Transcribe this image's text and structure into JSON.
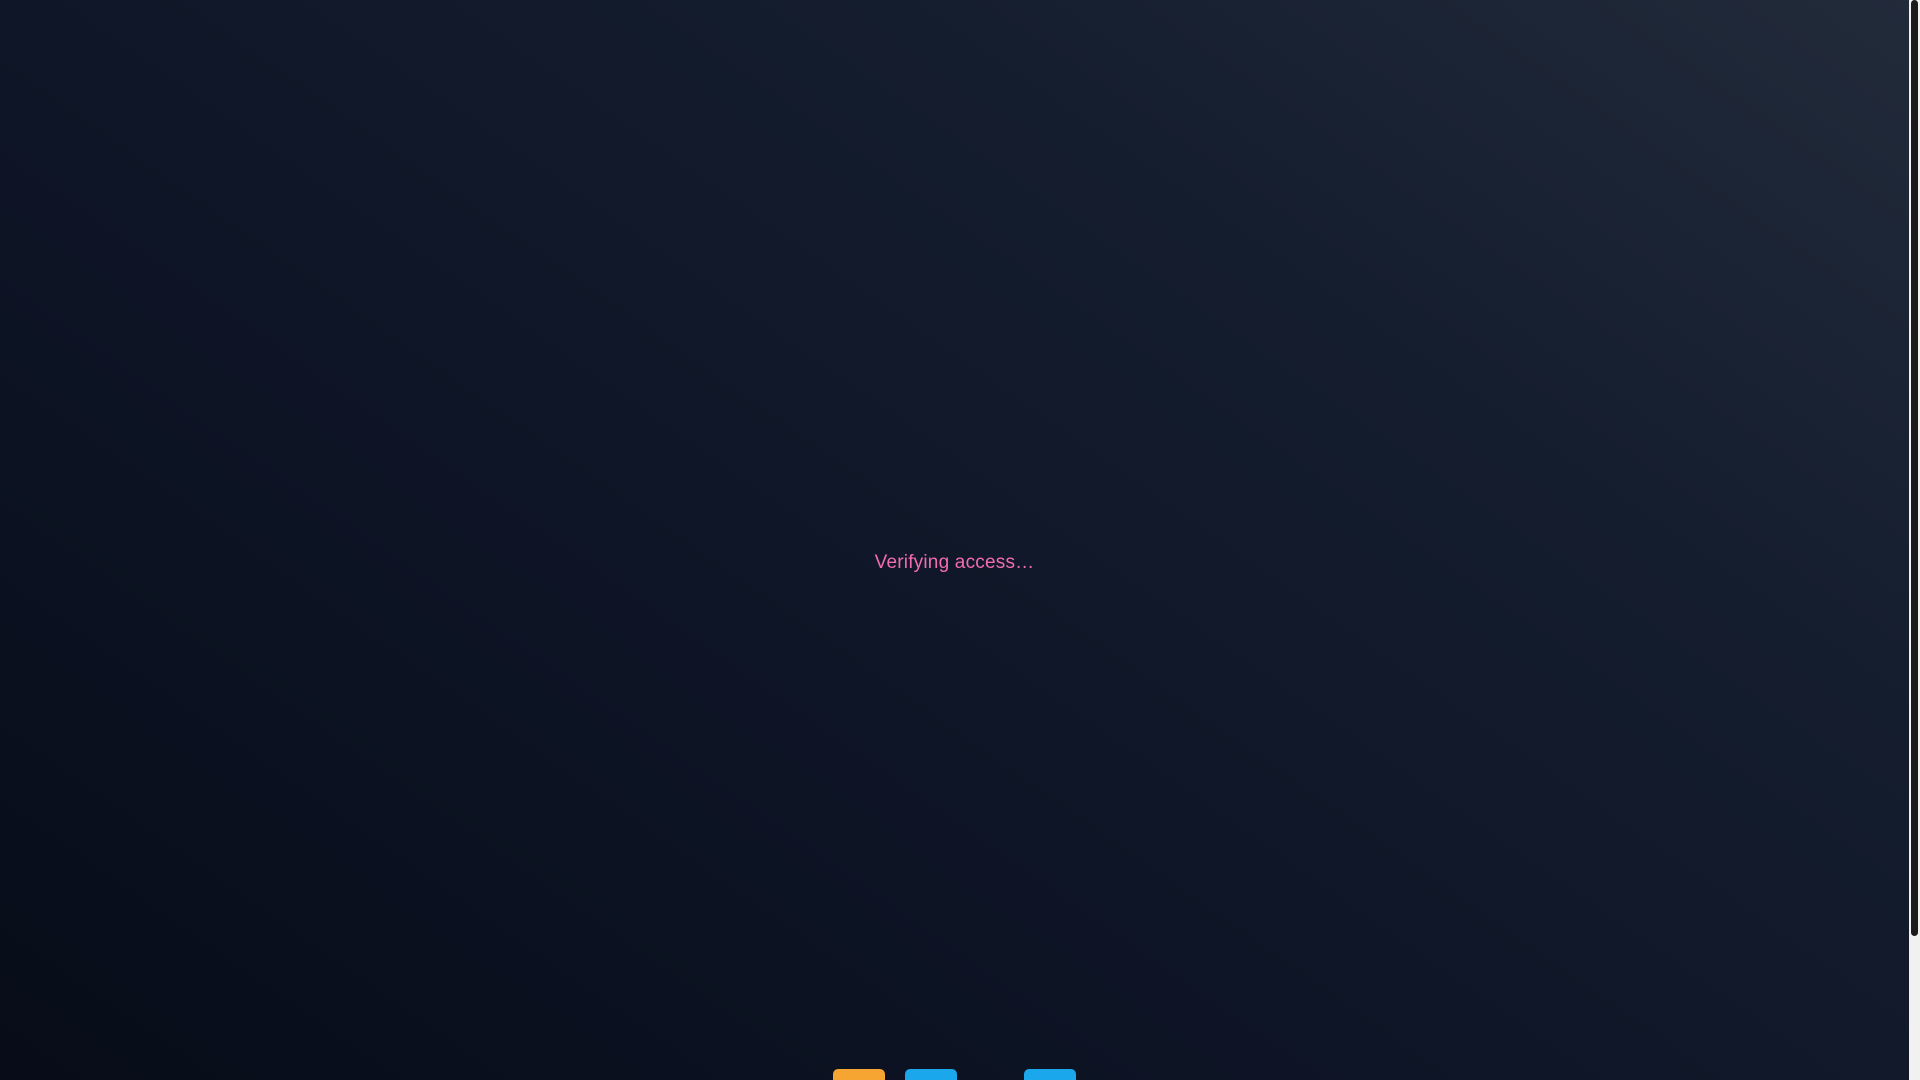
{
  "status": {
    "message": "Verifying access…"
  },
  "promo": {
    "icons": [
      "orange-emoji-icon",
      "blue-emoji-icon",
      "blue-emoji-icon"
    ],
    "colors": {
      "accent_text": "#f36bb2",
      "tile_orange": "#f6a432",
      "tile_blue": "#1aa7ec"
    }
  }
}
